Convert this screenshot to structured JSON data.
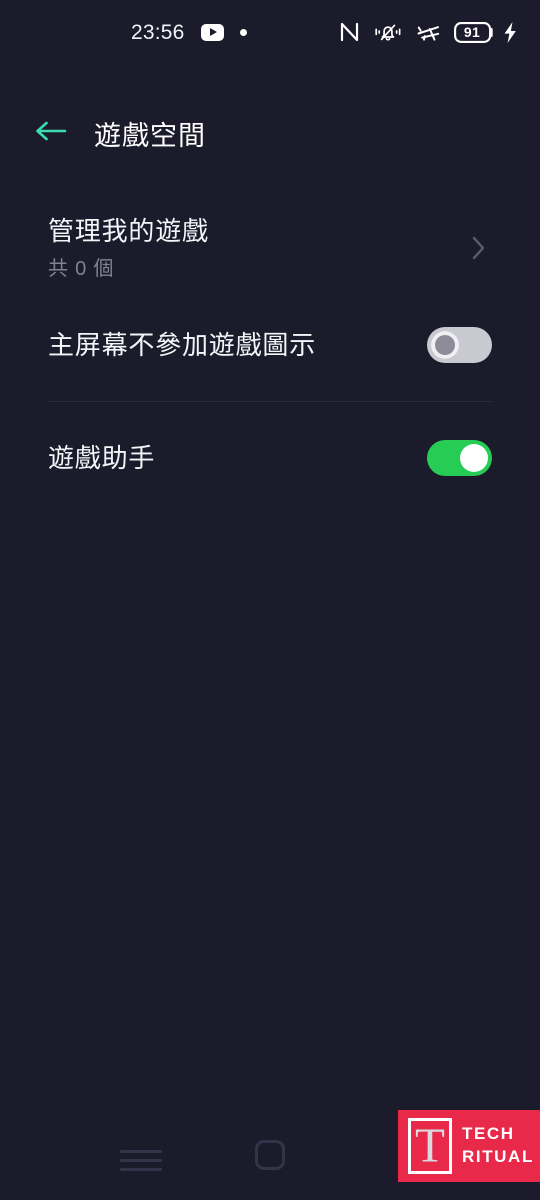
{
  "status_bar": {
    "time": "23:56",
    "left_icons": [
      "youtube-icon",
      "dot-icon"
    ],
    "right_icons": [
      "nfc-icon",
      "vibrate-icon",
      "airplane-mode-icon",
      "battery-icon",
      "charging-bolt-icon"
    ],
    "battery_level": "91"
  },
  "appbar": {
    "back_icon": "arrow-left-icon",
    "title": "遊戲空間",
    "accent_color": "#3ddcb0"
  },
  "list": {
    "rows": [
      {
        "name": "manage-my-games",
        "title": "管理我的遊戲",
        "subtitle": "共 0 個",
        "control": "chevron",
        "chevron_icon": "chevron-right-icon"
      },
      {
        "name": "hide-game-icons-on-home-screen",
        "title": "主屏幕不參加遊戲圖示",
        "control": "toggle",
        "toggle_state": "off"
      },
      {
        "name": "game-assistant",
        "title": "遊戲助手",
        "control": "toggle",
        "toggle_state": "on"
      }
    ]
  },
  "nav_bar": {
    "recents_icon": "recents-menu-icon",
    "home_icon": "home-square-icon"
  },
  "watermark": {
    "mark_letter": "T",
    "line1": "TECH",
    "line2": "RITUAL",
    "bg_color": "#e8294a"
  },
  "colors": {
    "background": "#1b1b2c",
    "toggle_on": "#27cc55",
    "toggle_off": "#c8c9d1",
    "accent": "#3ddcb0",
    "text_primary": "#f4f5f8",
    "text_secondary": "#81828f"
  }
}
